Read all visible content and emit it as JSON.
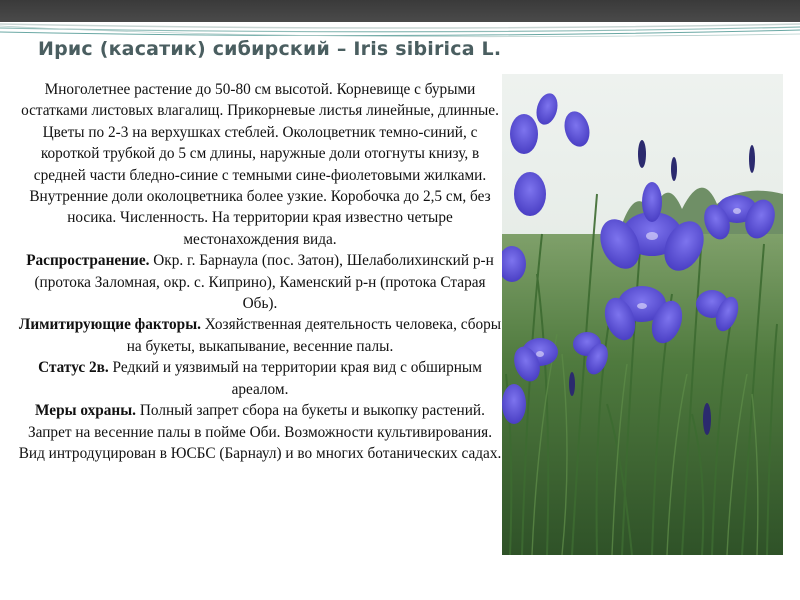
{
  "slide": {
    "title": "Ирис (касатик) сибирский – Iris sibirica L.",
    "description": "Многолетнее растение до 50-80 см высотой. Корневище с бурыми остатками листовых влагалищ. Прикорневые листья линейные, длинные. Цветы по 2-3 на верхушках стеблей. Околоцветник темно-синий, с короткой трубкой до 5 см длины, наружные доли отогнуты книзу, в средней части бледно-синие с темными сине-фиолетовыми жилками. Внутренние доли околоцветника более узкие. Коробочка до 2,5 см, без носика. Численность. На территории края известно четыре местонахождения вида.",
    "distribution_label": "Распространение.",
    "distribution_text": " Окр. г. Барнаула (пос. Затон), Шелаболихинский р-н (протока Заломная, окр. с. Киприно), Каменский р-н (протока Старая Обь).",
    "factors_label": "Лимитирующие факторы.",
    "factors_text": " Хозяйственная деятельность человека, сборы на букеты, выкапывание, весенние палы.",
    "status_label": "Статус 2в.",
    "status_text": "  Редкий и уязвимый на территории края вид с обширным ареалом.",
    "measures_label": "Меры охраны.",
    "measures_text": " Полный запрет сбора на букеты и выкопку растений. Запрет на весенние палы в пойме Оби. Возможности культивирования. Вид интродуцирован в ЮСБС (Барнаул) и во многих ботанических садах."
  },
  "colors": {
    "top_bar": "#3a3a3a",
    "title": "#4a5e60",
    "deco_teal": "#6aa8a4",
    "iris": "#5b4fd6"
  }
}
